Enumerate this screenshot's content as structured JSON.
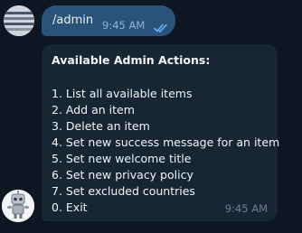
{
  "outgoing": {
    "text": "/admin",
    "time": "9:45 AM",
    "status_icon": "double-check-icon",
    "bubble_color": "#2b5278"
  },
  "incoming": {
    "heading": "Available Admin Actions:",
    "items": [
      "1. List all available items",
      "2. Add an item",
      "3. Delete an item",
      "4. Set new success message for an item",
      "5. Set new welcome title",
      "6. Set new privacy policy",
      "7. Set excluded countries",
      "0. Exit"
    ],
    "time": "9:45 AM",
    "bubble_color": "#182533"
  },
  "colors": {
    "background": "#0e1621",
    "accent": "#5eb5f7"
  }
}
